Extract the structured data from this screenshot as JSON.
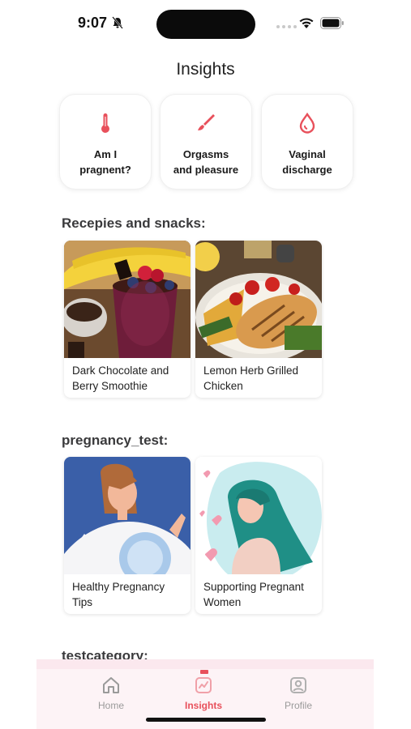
{
  "status": {
    "time": "9:07"
  },
  "header": {
    "title": "Insights"
  },
  "topics": [
    {
      "label": "Am I\npragnent?",
      "icon": "thermometer-icon"
    },
    {
      "label": "Orgasms\nand pleasure",
      "icon": "brush-icon"
    },
    {
      "label": "Vaginal\ndischarge",
      "icon": "droplet-icon"
    }
  ],
  "sections": [
    {
      "title": "Recepies and snacks:",
      "items": [
        {
          "title": "Dark Chocolate and Berry Smoothie"
        },
        {
          "title": "Lemon Herb Grilled Chicken"
        }
      ]
    },
    {
      "title": "pregnancy_test:",
      "items": [
        {
          "title": "Healthy Pregnancy Tips"
        },
        {
          "title": "Supporting Pregnant Women"
        }
      ]
    },
    {
      "title": "testcategory:"
    }
  ],
  "tabs": [
    {
      "label": "Home",
      "icon": "home-icon"
    },
    {
      "label": "Insights",
      "icon": "insights-icon",
      "active": true
    },
    {
      "label": "Profile",
      "icon": "profile-icon"
    }
  ],
  "colors": {
    "accent": "#e8505b",
    "tab_bg": "#fdf3f6"
  }
}
